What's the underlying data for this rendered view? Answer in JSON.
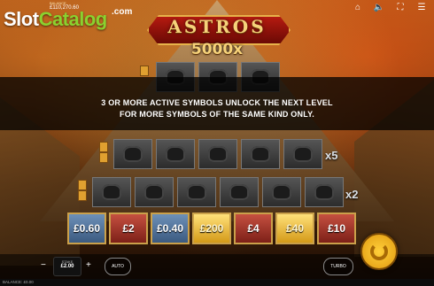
{
  "brand": {
    "part1": "Slot",
    "part2": "Catalog",
    "suffix": ".com"
  },
  "top": {
    "balance_label": "BALANCE",
    "balance_value": "£110,270.60"
  },
  "game": {
    "title": "ASTROS",
    "multiplier": "5000x"
  },
  "message": {
    "line1": "3 OR MORE ACTIVE SYMBOLS UNLOCK THE NEXT LEVEL",
    "line2": "FOR MORE SYMBOLS OF THE SAME KIND ONLY."
  },
  "rows": {
    "row5_mult": "x5",
    "row2_mult": "x2"
  },
  "prizes": [
    "£0.60",
    "£2",
    "£0.40",
    "£200",
    "£4",
    "£40",
    "£10"
  ],
  "controls": {
    "stake_label": "STAKE",
    "stake_value": "£2.00",
    "auto": "AUTO",
    "turbo": "TURBO",
    "minus": "−",
    "plus": "+"
  },
  "footer": {
    "balance": "BALANCE: £0.00"
  },
  "icons": [
    "home-icon",
    "sound-icon",
    "fullscreen-icon",
    "menu-icon"
  ],
  "colors": {
    "gold": "#f6d27a",
    "blue_tile": "#3b5a80",
    "red_tile": "#7d2018",
    "gold_tile": "#d49a18"
  }
}
